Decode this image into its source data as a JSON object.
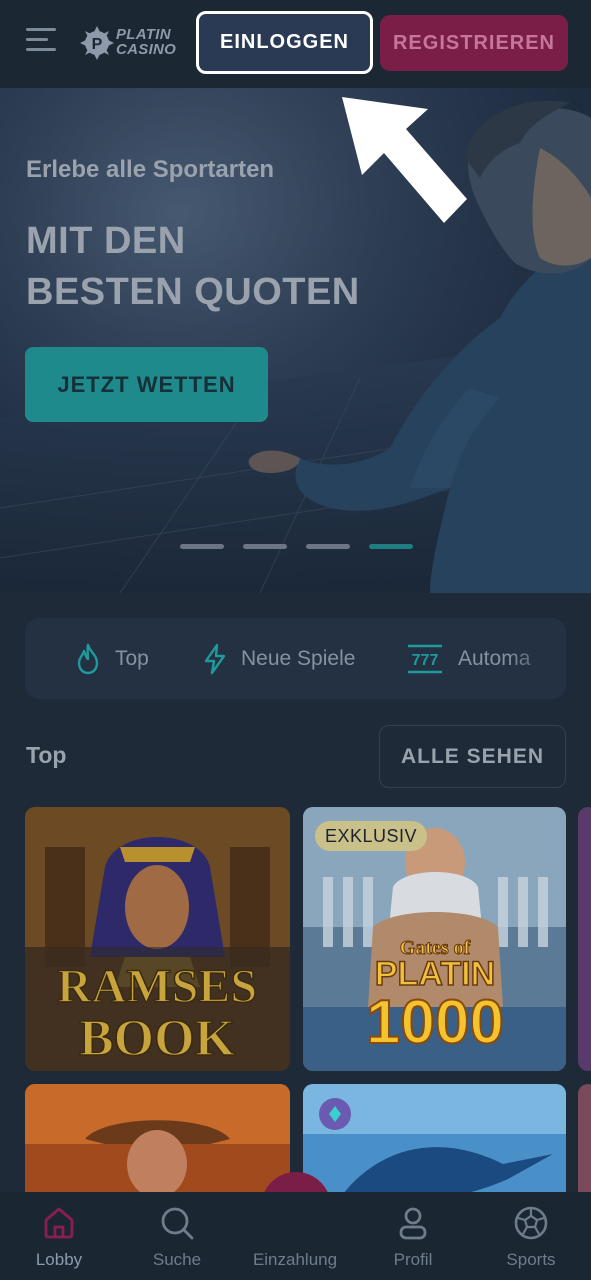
{
  "header": {
    "logo_line1": "PLATIN",
    "logo_line2": "CASINO",
    "login_label": "EINLOGGEN",
    "register_label": "REGISTRIEREN"
  },
  "hero": {
    "subtitle": "Erlebe alle Sportarten",
    "title_line1": "MIT DEN",
    "title_line2": "BESTEN QUOTEN",
    "cta_label": "JETZT WETTEN",
    "slide_count": 4,
    "active_slide": 4
  },
  "categories": [
    {
      "label": "Top",
      "icon": "flame-icon"
    },
    {
      "label": "Neue Spiele",
      "icon": "lightning-icon"
    },
    {
      "label": "Automa",
      "icon": "slot-777-icon"
    }
  ],
  "top_section": {
    "title": "Top",
    "see_all_label": "ALLE SEHEN"
  },
  "games": [
    {
      "title_line1": "RAMSES",
      "title_line2": "BOOK"
    },
    {
      "badge": "EXKLUSIV",
      "title_line1": "Gates of",
      "title_line2": "PLATIN",
      "title_line3": "1000"
    },
    {},
    {}
  ],
  "bottom_nav": [
    {
      "label": "Lobby",
      "icon": "home-icon",
      "active": true
    },
    {
      "label": "Suche",
      "icon": "search-icon"
    },
    {
      "label": "Einzahlung",
      "icon": "wallet-icon"
    },
    {
      "label": "Profil",
      "icon": "user-icon"
    },
    {
      "label": "Sports",
      "icon": "soccer-ball-icon"
    }
  ],
  "colors": {
    "accent_teal": "#1e8a8c",
    "brand_magenta": "#7a1e48",
    "background": "#1f2a38"
  }
}
